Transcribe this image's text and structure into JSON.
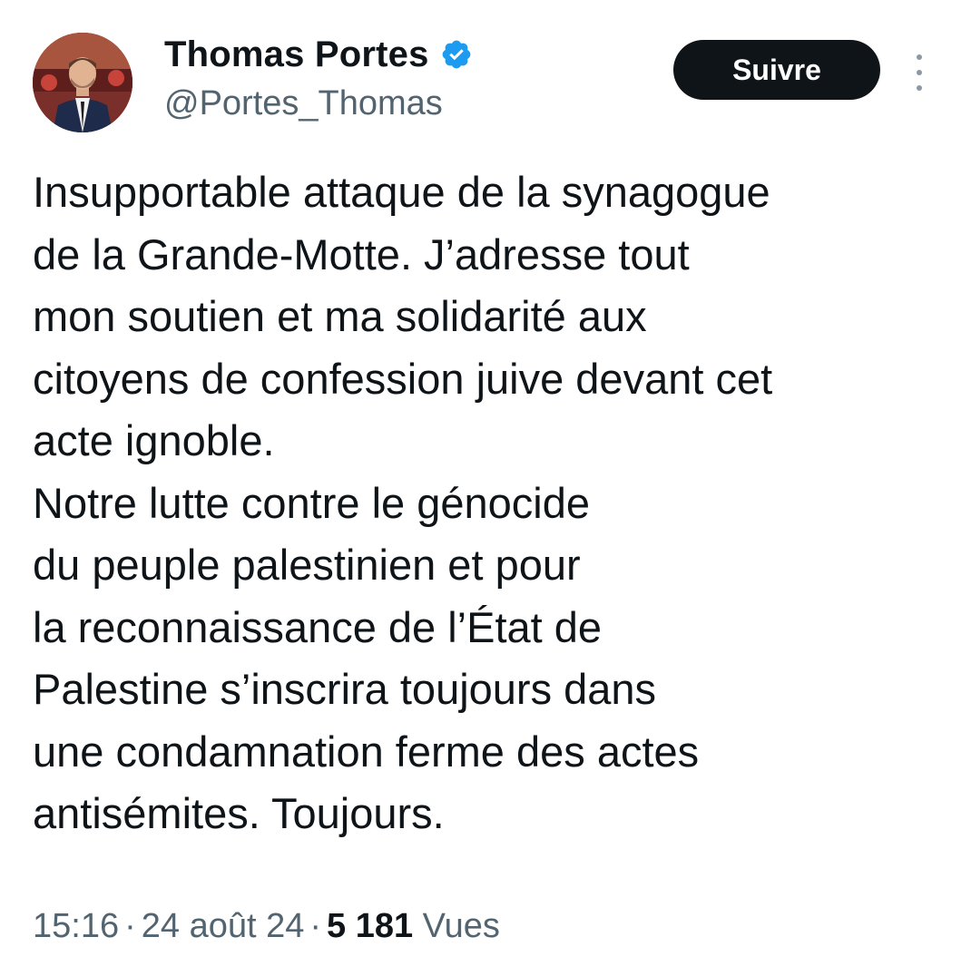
{
  "author": {
    "display_name": "Thomas Portes",
    "handle": "@Portes_Thomas",
    "verified_icon": "verified-badge-icon",
    "avatar_icon": "profile-photo"
  },
  "actions": {
    "follow_label": "Suivre",
    "more_icon": "more-vertical-icon"
  },
  "tweet": {
    "lines": [
      "Insupportable attaque de la synagogue",
      "de la Grande-Motte. J’adresse tout",
      "mon soutien et ma solidarité aux",
      "citoyens de confession juive devant cet",
      "acte ignoble.",
      "Notre lutte contre le génocide",
      "du peuple palestinien et pour",
      "la reconnaissance de l’État de",
      "Palestine s’inscrira toujours dans",
      "une condamnation ferme des actes",
      "antisémites. Toujours."
    ]
  },
  "meta": {
    "time": "15:16",
    "separator": "·",
    "date": "24 août 24",
    "views_count": "5 181",
    "views_label": "Vues"
  },
  "colors": {
    "text": "#0f1419",
    "secondary": "#536471",
    "verified": "#1d9bf0",
    "button_bg": "#0f1419",
    "button_text": "#ffffff"
  }
}
